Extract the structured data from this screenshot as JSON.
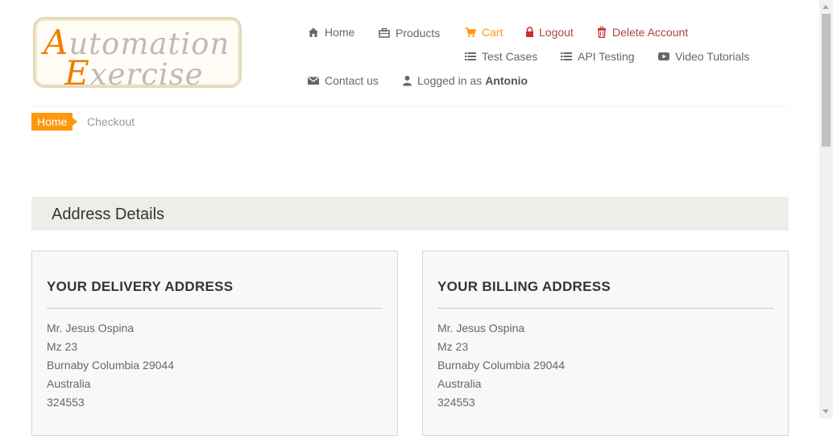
{
  "logo": {
    "line1_cap": "A",
    "line1_rest": "utomation",
    "line2_cap": "E",
    "line2_rest": "xercise"
  },
  "nav": {
    "home": "Home",
    "products": "Products",
    "cart": "Cart",
    "logout": "Logout",
    "delete_account": "Delete Account",
    "test_cases": "Test Cases",
    "api_testing": "API Testing",
    "video_tutorials": "Video Tutorials",
    "contact_us": "Contact us",
    "logged_in_prefix": "Logged in as",
    "username": "Antonio"
  },
  "breadcrumb": {
    "home": "Home",
    "current": "Checkout"
  },
  "section": {
    "title": "Address Details"
  },
  "delivery": {
    "heading": "YOUR DELIVERY ADDRESS",
    "lines": [
      "Mr. Jesus Ospina",
      "Mz 23",
      "Burnaby Columbia 29044",
      "Australia",
      "324553"
    ]
  },
  "billing": {
    "heading": "YOUR BILLING ADDRESS",
    "lines": [
      "Mr. Jesus Ospina",
      "Mz 23",
      "Burnaby Columbia 29044",
      "Australia",
      "324553"
    ]
  },
  "colors": {
    "accent": "#fe980f",
    "danger": "#a94442",
    "section_bg": "#efede7"
  }
}
